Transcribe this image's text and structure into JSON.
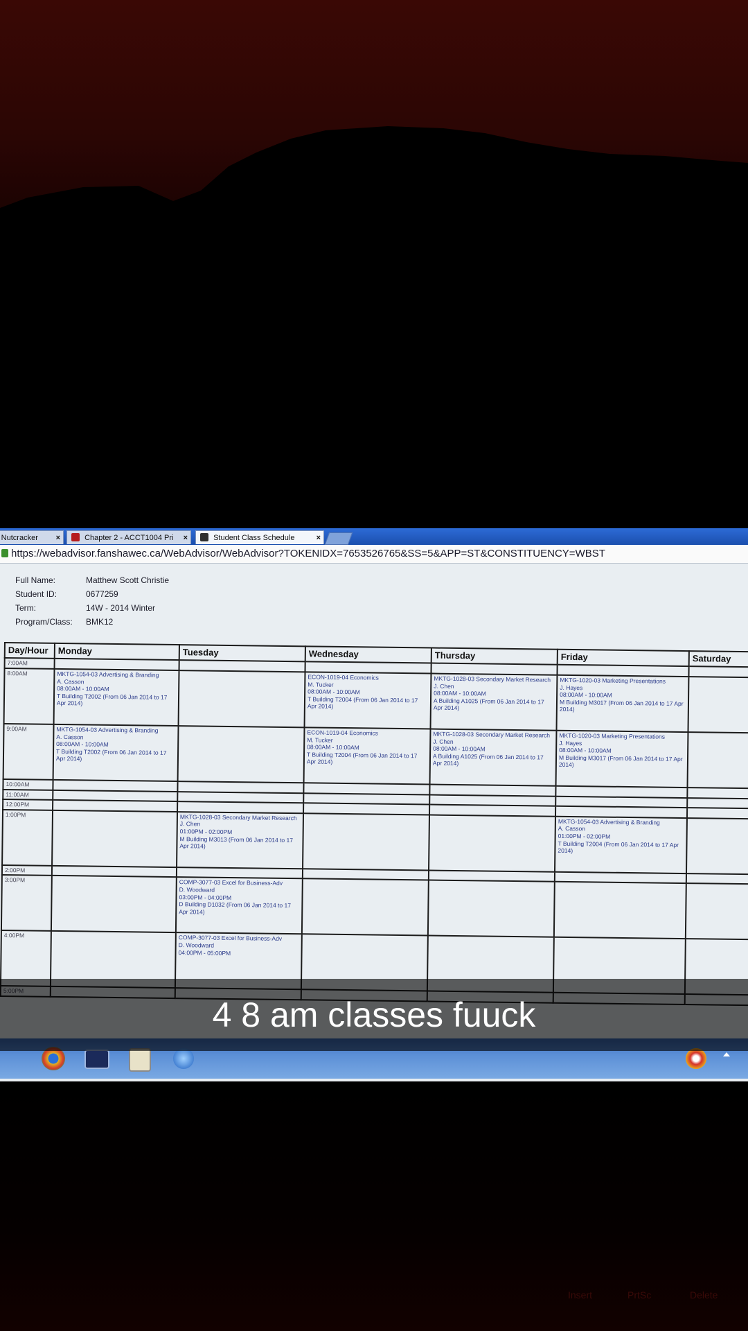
{
  "browser": {
    "tabs": [
      {
        "label": "ey Nutcracker",
        "active": false
      },
      {
        "label": "Chapter 2 - ACCT1004 Pri",
        "active": false
      },
      {
        "label": "Student Class Schedule",
        "active": true
      }
    ],
    "url": "https://webadvisor.fanshawec.ca/WebAdvisor/WebAdvisor?TOKENIDX=7653526765&SS=5&APP=ST&CONSTITUENCY=WBST"
  },
  "student": {
    "full_name_label": "Full Name:",
    "full_name": "Matthew Scott Christie",
    "id_label": "Student ID:",
    "id": "0677259",
    "term_label": "Term:",
    "term": "14W - 2014 Winter",
    "program_label": "Program/Class:",
    "program": "BMK12"
  },
  "schedule": {
    "headers": [
      "Day/Hour",
      "Monday",
      "Tuesday",
      "Wednesday",
      "Thursday",
      "Friday",
      "Saturday"
    ],
    "times": [
      "7:00AM",
      "8:00AM",
      "9:00AM",
      "10:00AM",
      "11:00AM",
      "12:00PM",
      "1:00PM",
      "2:00PM",
      "3:00PM",
      "4:00PM",
      "5:00PM"
    ],
    "rows": [
      [
        "",
        "",
        "",
        "",
        "",
        ""
      ],
      [
        "MKTG-1054-03 Advertising & Branding\nA. Casson\n08:00AM - 10:00AM\nT Building T2002 (From 06 Jan 2014 to 17 Apr 2014)",
        "",
        "ECON-1019-04 Economics\nM. Tucker\n08:00AM - 10:00AM\nT Building T2004 (From 06 Jan 2014 to 17 Apr 2014)",
        "MKTG-1028-03 Secondary Market Research\nJ. Chen\n08:00AM - 10:00AM\nA Building A1025 (From 06 Jan 2014 to 17 Apr 2014)",
        "MKTG-1020-03 Marketing Presentations\nJ. Hayes\n08:00AM - 10:00AM\nM Building M3017 (From 06 Jan 2014 to 17 Apr 2014)",
        ""
      ],
      [
        "MKTG-1054-03 Advertising & Branding\nA. Casson\n08:00AM - 10:00AM\nT Building T2002 (From 06 Jan 2014 to 17 Apr 2014)",
        "",
        "ECON-1019-04 Economics\nM. Tucker\n08:00AM - 10:00AM\nT Building T2004 (From 06 Jan 2014 to 17 Apr 2014)",
        "MKTG-1028-03 Secondary Market Research\nJ. Chen\n08:00AM - 10:00AM\nA Building A1025 (From 06 Jan 2014 to 17 Apr 2014)",
        "MKTG-1020-03 Marketing Presentations\nJ. Hayes\n08:00AM - 10:00AM\nM Building M3017 (From 06 Jan 2014 to 17 Apr 2014)",
        ""
      ],
      [
        "",
        "",
        "",
        "",
        "",
        ""
      ],
      [
        "",
        "",
        "",
        "",
        "",
        ""
      ],
      [
        "",
        "",
        "",
        "",
        "",
        ""
      ],
      [
        "",
        "MKTG-1028-03 Secondary Market Research\nJ. Chen\n01:00PM - 02:00PM\nM Building M3013 (From 06 Jan 2014 to 17 Apr 2014)",
        "",
        "",
        "MKTG-1054-03 Advertising & Branding\nA. Casson\n01:00PM - 02:00PM\nT Building T2004 (From 06 Jan 2014 to 17 Apr 2014)",
        ""
      ],
      [
        "",
        "",
        "",
        "",
        "",
        ""
      ],
      [
        "",
        "COMP-3077-03 Excel for Business-Adv\nD. Woodward\n03:00PM - 04:00PM\nD Building D1032 (From 06 Jan 2014 to 17 Apr 2014)",
        "",
        "",
        "",
        ""
      ],
      [
        "",
        "COMP-3077-03 Excel for Business-Adv\nD. Woodward\n04:00PM - 05:00PM",
        "",
        "",
        "",
        ""
      ],
      [
        "",
        "",
        "",
        "",
        "",
        ""
      ]
    ]
  },
  "caption": "4 8 am classes fuuck",
  "keyboard_keys": [
    "Insert",
    "PrtSc",
    "Delete"
  ],
  "colors": {
    "tabbar": "#1b4fae",
    "schedule_text": "#2a3a8a",
    "caption_bg": "#000000"
  }
}
